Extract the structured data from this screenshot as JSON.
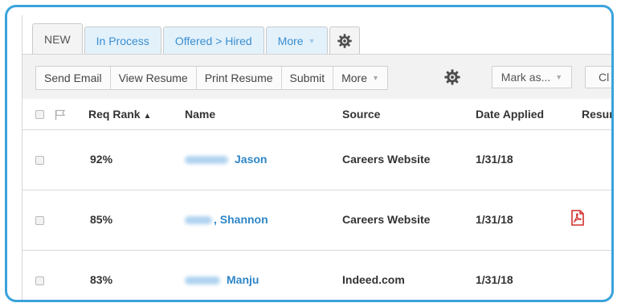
{
  "tabs": [
    {
      "label": "NEW",
      "active": true
    },
    {
      "label": "In Process",
      "active": false
    },
    {
      "label": "Offered > Hired",
      "active": false
    },
    {
      "label": "More",
      "active": false,
      "dropdown": true
    }
  ],
  "tab_settings_icon": "gear-icon",
  "toolbar": {
    "buttons": [
      "Send Email",
      "View Resume",
      "Print Resume",
      "Submit"
    ],
    "more_label": "More",
    "settings_icon": "gear-icon",
    "mark_as_label": "Mark as...",
    "clipped_label": "Cl"
  },
  "table": {
    "columns": [
      "Req Rank",
      "Name",
      "Source",
      "Date Applied",
      "Resur"
    ],
    "sort_indicator": "▲",
    "rows": [
      {
        "rank": "92%",
        "name": "Jason",
        "name_prefix": "",
        "source": "Careers Website",
        "date": "1/31/18",
        "resume_icon": ""
      },
      {
        "rank": "85%",
        "name": "Shannon",
        "name_prefix": ",",
        "source": "Careers Website",
        "date": "1/31/18",
        "resume_icon": "pdf-icon"
      },
      {
        "rank": "83%",
        "name": "Manju",
        "name_prefix": "",
        "source": "Indeed.com",
        "date": "1/31/18",
        "resume_icon": ""
      }
    ]
  },
  "colors": {
    "accent": "#3aa3dc",
    "link": "#2f86c8",
    "tab_bg": "#e3f1fb",
    "pdf": "#d0312d"
  }
}
